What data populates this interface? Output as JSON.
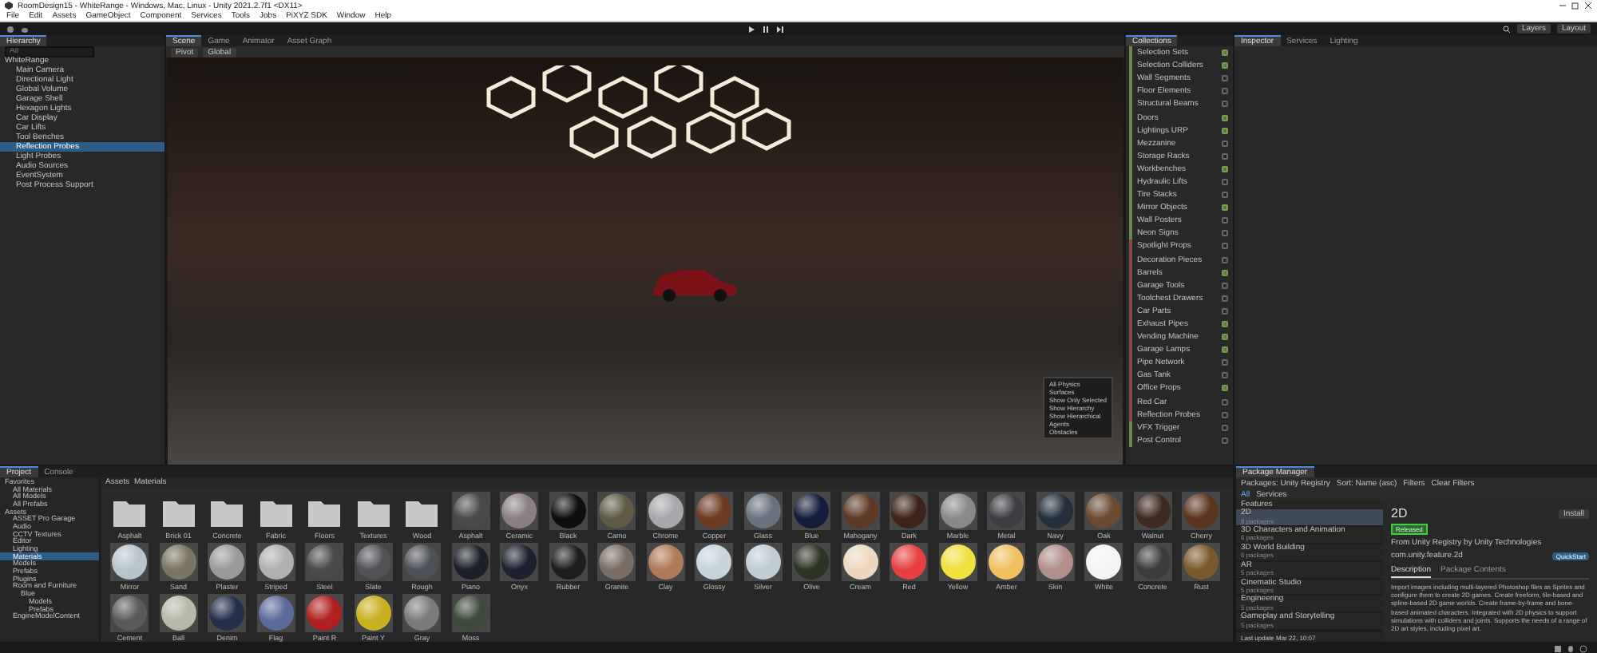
{
  "window": {
    "title": "RoomDesign15 - WhiteRange - Windows, Mac, Linux - Unity 2021.2.7f1 <DX11>"
  },
  "menu": [
    "File",
    "Edit",
    "Assets",
    "GameObject",
    "Component",
    "Services",
    "Tools",
    "Jobs",
    "PiXYZ SDK",
    "Window",
    "Help"
  ],
  "toolbar": {
    "layers": "Layers",
    "layout": "Layout"
  },
  "hierarchy": {
    "title": "Hierarchy",
    "search_placeholder": "All",
    "scene": "WhiteRange",
    "items": [
      {
        "label": "Main Camera",
        "selected": false
      },
      {
        "label": "Directional Light",
        "selected": false
      },
      {
        "label": "Global Volume",
        "selected": false
      },
      {
        "label": "Garage Shell",
        "selected": false
      },
      {
        "label": "Hexagon Lights",
        "selected": false
      },
      {
        "label": "Car Display",
        "selected": false
      },
      {
        "label": "Car Lifts",
        "selected": false
      },
      {
        "label": "Tool Benches",
        "selected": false
      },
      {
        "label": "Reflection Probes",
        "selected": true
      },
      {
        "label": "Light Probes",
        "selected": false
      },
      {
        "label": "Audio Sources",
        "selected": false
      },
      {
        "label": "EventSystem",
        "selected": false
      },
      {
        "label": "Post Process Support",
        "selected": false
      }
    ]
  },
  "scene": {
    "tabs": [
      {
        "label": "Scene",
        "selected": true
      },
      {
        "label": "Game",
        "selected": false
      },
      {
        "label": "Animator",
        "selected": false
      },
      {
        "label": "Asset Graph",
        "selected": false
      }
    ],
    "tools": [
      "Pivot",
      "Global"
    ],
    "overlay_menu": [
      "All Physics",
      "Surfaces",
      "Show Only Selected",
      "Show Hierarchy",
      "Show Hierarchical",
      "Agents",
      "Obstacles"
    ]
  },
  "collections": {
    "title": "Collections",
    "items": [
      {
        "label": "Selection Sets",
        "color": "#6a8a4a",
        "checked": true
      },
      {
        "label": "Selection Colliders",
        "color": "#6a8a4a",
        "checked": true
      },
      {
        "label": "Wall Segments",
        "color": "#6a8a4a",
        "checked": false
      },
      {
        "label": "Floor Elements",
        "color": "#6a8a4a",
        "checked": false
      },
      {
        "label": "Structural Beams",
        "color": "#6a8a4a",
        "checked": false
      },
      {
        "label": "Doors",
        "color": "#6a8a4a",
        "checked": true
      },
      {
        "label": "Lightings URP",
        "color": "#6a8a4a",
        "checked": true
      },
      {
        "label": "Mezzanine",
        "color": "#6a8a4a",
        "checked": false
      },
      {
        "label": "Storage Racks",
        "color": "#6a8a4a",
        "checked": false
      },
      {
        "label": "Workbenches",
        "color": "#6a8a4a",
        "checked": true
      },
      {
        "label": "Hydraulic Lifts",
        "color": "#6a8a4a",
        "checked": false
      },
      {
        "label": "Tire Stacks",
        "color": "#6a8a4a",
        "checked": false
      },
      {
        "label": "Mirror Objects",
        "color": "#6a8a4a",
        "checked": true
      },
      {
        "label": "Wall Posters",
        "color": "#6a8a4a",
        "checked": false
      },
      {
        "label": "Neon Signs",
        "color": "#6a8a4a",
        "checked": false
      },
      {
        "label": "Spotlight Props",
        "color": "#8a4a4a",
        "checked": false
      },
      {
        "label": "Decoration Pieces",
        "color": "#8a4a4a",
        "checked": false
      },
      {
        "label": "Barrels",
        "color": "#8a4a4a",
        "checked": true
      },
      {
        "label": "Garage Tools",
        "color": "#8a4a4a",
        "checked": false
      },
      {
        "label": "Toolchest Drawers",
        "color": "#8a4a4a",
        "checked": false
      },
      {
        "label": "Car Parts",
        "color": "#8a4a4a",
        "checked": false
      },
      {
        "label": "Exhaust Pipes",
        "color": "#8a4a4a",
        "checked": true
      },
      {
        "label": "Vending Machine",
        "color": "#8a4a4a",
        "checked": true
      },
      {
        "label": "Garage Lamps",
        "color": "#8a4a4a",
        "checked": true
      },
      {
        "label": "Pipe Network",
        "color": "#8a4a4a",
        "checked": false
      },
      {
        "label": "Gas Tank",
        "color": "#8a4a4a",
        "checked": false
      },
      {
        "label": "Office Props",
        "color": "#8a4a4a",
        "checked": true
      },
      {
        "label": "Red Car",
        "color": "#8a4a4a",
        "checked": false
      },
      {
        "label": "Reflection Probes",
        "color": "#8a4a4a",
        "checked": false
      },
      {
        "label": "VFX Trigger",
        "color": "#6a8a4a",
        "checked": false
      },
      {
        "label": "Post Control",
        "color": "#6a8a4a",
        "checked": false
      }
    ]
  },
  "inspector": {
    "tabs": [
      {
        "label": "Inspector",
        "selected": true
      },
      {
        "label": "Services",
        "selected": false
      },
      {
        "label": "Lighting",
        "selected": false
      }
    ]
  },
  "project": {
    "tabs": [
      {
        "label": "Project",
        "selected": true
      },
      {
        "label": "Console",
        "selected": false
      }
    ],
    "tree": [
      {
        "label": "Favorites",
        "selected": false,
        "children": [
          {
            "label": "All Materials",
            "selected": false
          },
          {
            "label": "All Models",
            "selected": false
          },
          {
            "label": "All Prefabs",
            "selected": false
          }
        ]
      },
      {
        "label": "Assets",
        "selected": false,
        "children": [
          {
            "label": "ASSET Pro Garage",
            "selected": false
          },
          {
            "label": "Audio",
            "selected": false
          },
          {
            "label": "CCTV Textures",
            "selected": false
          },
          {
            "label": "Editor",
            "selected": false
          },
          {
            "label": "Lighting",
            "selected": false
          },
          {
            "label": "Materials",
            "selected": true
          },
          {
            "label": "Models",
            "selected": false
          },
          {
            "label": "Prefabs",
            "selected": false
          },
          {
            "label": "Plugins",
            "selected": false
          },
          {
            "label": "Room and Furniture",
            "selected": false,
            "children": [
              {
                "label": "Blue",
                "selected": false,
                "children": [
                  {
                    "label": "Models",
                    "selected": false
                  },
                  {
                    "label": "Prefabs",
                    "selected": false
                  }
                ]
              }
            ]
          },
          {
            "label": "EngineModelContent",
            "selected": false
          }
        ]
      }
    ],
    "breadcrumb": [
      "Assets",
      "Materials"
    ],
    "assets": [
      {
        "kind": "folder",
        "label": "Asphalt"
      },
      {
        "kind": "folder",
        "label": "Brick 01"
      },
      {
        "kind": "folder",
        "label": "Concrete"
      },
      {
        "kind": "folder",
        "label": "Fabric"
      },
      {
        "kind": "folder",
        "label": "Floors"
      },
      {
        "kind": "folder",
        "label": "Textures"
      },
      {
        "kind": "folder",
        "label": "Wood"
      },
      {
        "kind": "material",
        "label": "Asphalt",
        "color": "#4a4a4a"
      },
      {
        "kind": "material",
        "label": "Ceramic",
        "color": "#8a7f84"
      },
      {
        "kind": "material",
        "label": "Black",
        "color": "#0e0e0e"
      },
      {
        "kind": "material",
        "label": "Camo",
        "color": "#5e5a44"
      },
      {
        "kind": "material",
        "label": "Chrome",
        "color": "#a8a8ac"
      },
      {
        "kind": "material",
        "label": "Copper",
        "color": "#6e3a22"
      },
      {
        "kind": "material",
        "label": "Glass",
        "color": "#6a727e"
      },
      {
        "kind": "material",
        "label": "Blue",
        "color": "#141d3a"
      },
      {
        "kind": "material",
        "label": "Mahogany",
        "color": "#5c3a24"
      },
      {
        "kind": "material",
        "label": "Dark",
        "color": "#3c2418"
      },
      {
        "kind": "material",
        "label": "Marble",
        "color": "#8c8a88"
      },
      {
        "kind": "material",
        "label": "Metal",
        "color": "#3c3c42"
      },
      {
        "kind": "material",
        "label": "Navy",
        "color": "#25303e"
      },
      {
        "kind": "material",
        "label": "Oak",
        "color": "#6a4a32"
      },
      {
        "kind": "material",
        "label": "Walnut",
        "color": "#3e2a20"
      },
      {
        "kind": "material",
        "label": "Cherry",
        "color": "#5a3420"
      },
      {
        "kind": "material",
        "label": "Mirror",
        "color": "#b8c4cc"
      },
      {
        "kind": "material",
        "label": "Sand",
        "color": "#7a7462"
      },
      {
        "kind": "material",
        "label": "Plaster",
        "color": "#9a9a98"
      },
      {
        "kind": "material",
        "label": "Striped",
        "color": "#b0b0b0"
      },
      {
        "kind": "material",
        "label": "Steel",
        "color": "#4a4a4c"
      },
      {
        "kind": "material",
        "label": "Slate",
        "color": "#505256"
      },
      {
        "kind": "material",
        "label": "Rough",
        "color": "#4e5058"
      },
      {
        "kind": "material",
        "label": "Piano",
        "color": "#1c2028"
      },
      {
        "kind": "material",
        "label": "Onyx",
        "color": "#1e2230"
      },
      {
        "kind": "material",
        "label": "Rubber",
        "color": "#1e1e1e"
      },
      {
        "kind": "material",
        "label": "Granite",
        "color": "#7a6e64"
      },
      {
        "kind": "material",
        "label": "Clay",
        "color": "#b07a58"
      },
      {
        "kind": "material",
        "label": "Glossy",
        "color": "#c8d4dc"
      },
      {
        "kind": "material",
        "label": "Silver",
        "color": "#c0ccd4"
      },
      {
        "kind": "material",
        "label": "Olive",
        "color": "#2e3424"
      },
      {
        "kind": "material",
        "label": "Cream",
        "color": "#ecd8c0"
      },
      {
        "kind": "material",
        "label": "Red",
        "color": "#e84040"
      },
      {
        "kind": "material",
        "label": "Yellow",
        "color": "#f0e040"
      },
      {
        "kind": "material",
        "label": "Amber",
        "color": "#f0c060"
      },
      {
        "kind": "material",
        "label": "Skin",
        "color": "#b09088"
      },
      {
        "kind": "material",
        "label": "White",
        "color": "#f4f4f4"
      },
      {
        "kind": "material",
        "label": "Concrete",
        "color": "#3c3c3a"
      },
      {
        "kind": "material",
        "label": "Rust",
        "color": "#7a5a2a"
      },
      {
        "kind": "material",
        "label": "Cement",
        "color": "#5a5a5a"
      },
      {
        "kind": "material",
        "label": "Ball",
        "color": "#b8b8a8"
      },
      {
        "kind": "material",
        "label": "Denim",
        "color": "#24304a"
      },
      {
        "kind": "material",
        "label": "Flag",
        "color": "#5a6a9a"
      },
      {
        "kind": "material",
        "label": "Paint R",
        "color": "#b02020"
      },
      {
        "kind": "material",
        "label": "Paint Y",
        "color": "#c8b020"
      },
      {
        "kind": "material",
        "label": "Gray",
        "color": "#7a7a7a"
      },
      {
        "kind": "material",
        "label": "Moss",
        "color": "#3e4a3a"
      }
    ]
  },
  "package_manager": {
    "title": "Package Manager",
    "filters": [
      "Packages: Unity Registry",
      "Sort: Name (asc)",
      "Filters",
      "Clear Filters"
    ],
    "tabs": [
      {
        "label": "All",
        "selected": true
      },
      {
        "label": "Services",
        "selected": false
      }
    ],
    "section": "Features",
    "packages": [
      {
        "name": "2D",
        "count": "8 packages",
        "selected": true
      },
      {
        "name": "3D Characters and Animation",
        "count": "6 packages",
        "selected": false
      },
      {
        "name": "3D World Building",
        "count": "6 packages",
        "selected": false
      },
      {
        "name": "AR",
        "count": "5 packages",
        "selected": false
      },
      {
        "name": "Cinematic Studio",
        "count": "5 packages",
        "selected": false
      },
      {
        "name": "Engineering",
        "count": "5 packages",
        "selected": false
      },
      {
        "name": "Gameplay and Storytelling",
        "count": "5 packages",
        "selected": false
      }
    ],
    "last_update": "Last update Mar 22, 10:07",
    "detail": {
      "name": "2D",
      "badge": "Released",
      "publisher": "From Unity Registry by Unity Technologies",
      "id": "com.unity.feature.2d",
      "install": "Install",
      "documentation": "QuickStart",
      "tabs": [
        {
          "label": "Description",
          "selected": true
        },
        {
          "label": "Package Contents",
          "selected": false
        }
      ],
      "description": "Import images including multi-layered Photoshop files as Sprites and configure them to create 2D games. Create freeform, tile-based and spline-based 2D game worlds. Create frame-by-frame and bone-based animated characters. Integrated with 2D physics to support simulations with colliders and joints. Supports the needs of a range of 2D art styles, including pixel art."
    }
  }
}
